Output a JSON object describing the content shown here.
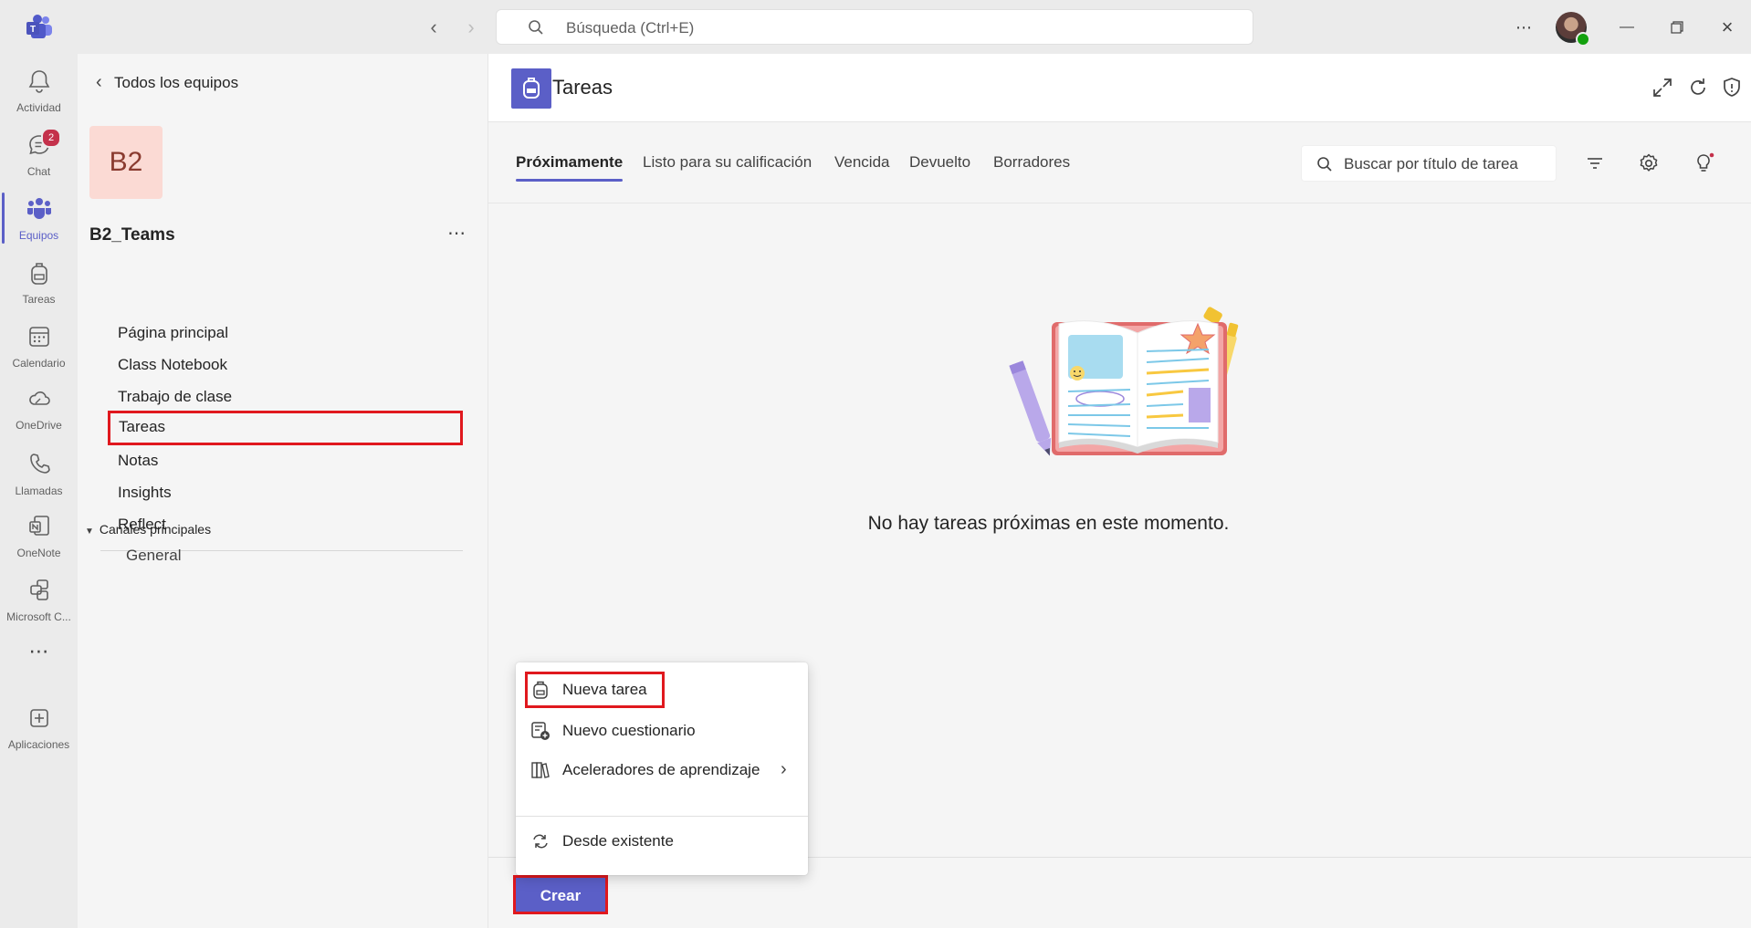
{
  "titlebar": {
    "search_placeholder": "Búsqueda (Ctrl+E)"
  },
  "rail": {
    "items": [
      {
        "label": "Actividad",
        "icon": "bell-icon"
      },
      {
        "label": "Chat",
        "icon": "chat-icon",
        "badge": "2"
      },
      {
        "label": "Equipos",
        "icon": "teams-icon",
        "active": true
      },
      {
        "label": "Tareas",
        "icon": "backpack-icon"
      },
      {
        "label": "Calendario",
        "icon": "calendar-icon"
      },
      {
        "label": "OneDrive",
        "icon": "cloud-icon"
      },
      {
        "label": "Llamadas",
        "icon": "phone-icon"
      },
      {
        "label": "OneNote",
        "icon": "onenote-icon"
      },
      {
        "label": "Microsoft C...",
        "icon": "copilot-icon"
      },
      {
        "label": "Aplicaciones",
        "icon": "add-app-icon"
      }
    ]
  },
  "team_panel": {
    "back_label": "Todos los equipos",
    "avatar_text": "B2",
    "team_name": "B2_Teams",
    "nav": [
      {
        "label": "Página principal"
      },
      {
        "label": "Class Notebook"
      },
      {
        "label": "Trabajo de clase"
      },
      {
        "label": "Tareas",
        "highlighted": true
      },
      {
        "label": "Notas"
      },
      {
        "label": "Insights"
      },
      {
        "label": "Reflect"
      }
    ],
    "channels_header": "Canales principales",
    "channels": [
      "General"
    ]
  },
  "app": {
    "title": "Tareas",
    "tabs": [
      {
        "label": "Próximamente",
        "active": true
      },
      {
        "label": "Listo para su calificación"
      },
      {
        "label": "Vencida"
      },
      {
        "label": "Devuelto"
      },
      {
        "label": "Borradores"
      }
    ],
    "task_search_placeholder": "Buscar por título de tarea",
    "empty_message": "No hay tareas próximas en este momento.",
    "create_label": "Crear"
  },
  "create_menu": {
    "items": [
      {
        "label": "Nueva tarea",
        "icon": "backpack-icon",
        "highlighted": true
      },
      {
        "label": "Nuevo cuestionario",
        "icon": "quiz-icon"
      },
      {
        "label": "Aceleradores de aprendizaje",
        "icon": "books-icon",
        "submenu": true
      },
      {
        "label": "Desde existente",
        "icon": "reuse-icon"
      }
    ]
  },
  "colors": {
    "accent": "#5b5fc7",
    "highlight_border": "#e0181e",
    "badge": "#c4314b",
    "presence": "#13a10e"
  }
}
